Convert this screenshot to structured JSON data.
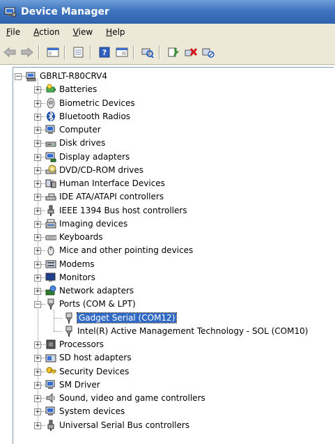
{
  "window": {
    "title": "Device Manager"
  },
  "menu": [
    "File",
    "Action",
    "View",
    "Help"
  ],
  "toolbar": {
    "buttons": [
      "back-icon",
      "forward-icon",
      "properties-view-icon",
      "show-hide-console-icon",
      "help-icon",
      "view-icon",
      "scan-hardware-icon",
      "update-driver-icon",
      "uninstall-icon",
      "disable-icon"
    ]
  },
  "tree": {
    "root": "GBRLT-R80CRV4",
    "categories": [
      {
        "label": "Batteries",
        "icon": "battery-icon"
      },
      {
        "label": "Biometric Devices",
        "icon": "biometric-icon"
      },
      {
        "label": "Bluetooth Radios",
        "icon": "bluetooth-icon"
      },
      {
        "label": "Computer",
        "icon": "computer-icon"
      },
      {
        "label": "Disk drives",
        "icon": "disk-drive-icon"
      },
      {
        "label": "Display adapters",
        "icon": "display-adapter-icon"
      },
      {
        "label": "DVD/CD-ROM drives",
        "icon": "dvd-drive-icon"
      },
      {
        "label": "Human Interface Devices",
        "icon": "hid-icon"
      },
      {
        "label": "IDE ATA/ATAPI controllers",
        "icon": "ide-controller-icon"
      },
      {
        "label": "IEEE 1394 Bus host controllers",
        "icon": "ieee1394-icon"
      },
      {
        "label": "Imaging devices",
        "icon": "imaging-device-icon"
      },
      {
        "label": "Keyboards",
        "icon": "keyboard-icon"
      },
      {
        "label": "Mice and other pointing devices",
        "icon": "mouse-icon"
      },
      {
        "label": "Modems",
        "icon": "modem-icon"
      },
      {
        "label": "Monitors",
        "icon": "monitor-icon"
      },
      {
        "label": "Network adapters",
        "icon": "network-adapter-icon"
      },
      {
        "label": "Ports (COM & LPT)",
        "icon": "port-icon",
        "expanded": true,
        "children": [
          "Gadget Serial (COM12)",
          "Intel(R) Active Management Technology - SOL (COM10)"
        ],
        "selected_child": 0
      },
      {
        "label": "Processors",
        "icon": "processor-icon"
      },
      {
        "label": "SD host adapters",
        "icon": "sd-host-icon"
      },
      {
        "label": "Security Devices",
        "icon": "security-device-icon"
      },
      {
        "label": "SM Driver",
        "icon": "sm-driver-icon"
      },
      {
        "label": "Sound, video and game controllers",
        "icon": "sound-icon"
      },
      {
        "label": "System devices",
        "icon": "system-device-icon"
      },
      {
        "label": "Universal Serial Bus controllers",
        "icon": "usb-icon"
      }
    ]
  }
}
